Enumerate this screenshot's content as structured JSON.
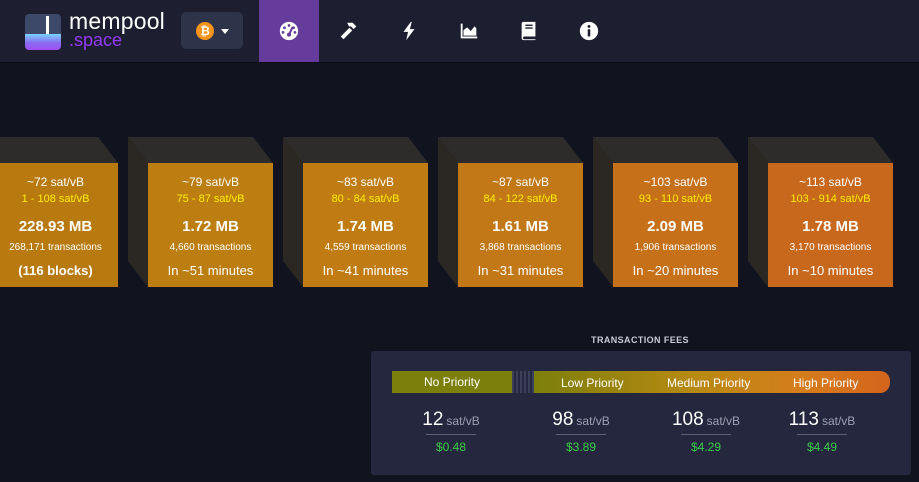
{
  "brand": {
    "name_line1": "mempool",
    "name_line2": ".space",
    "accent": "#9339f4"
  },
  "nav": {
    "network_icon": "bitcoin-icon",
    "items": [
      {
        "icon": "dashboard-gauge-icon",
        "active": true
      },
      {
        "icon": "hammer-icon",
        "active": false
      },
      {
        "icon": "lightning-icon",
        "active": false
      },
      {
        "icon": "graphs-icon",
        "active": false
      },
      {
        "icon": "book-icon",
        "active": false
      },
      {
        "icon": "info-icon",
        "active": false
      }
    ]
  },
  "mempool_blocks": [
    {
      "fee": "~72 sat/vB",
      "range": "1 - 108 sat/vB",
      "size": "228.93 MB",
      "txs": "268,171 transactions",
      "eta": "(116 blocks)"
    },
    {
      "fee": "~79 sat/vB",
      "range": "75 - 87 sat/vB",
      "size": "1.72 MB",
      "txs": "4,660 transactions",
      "eta": "In ~51 minutes"
    },
    {
      "fee": "~83 sat/vB",
      "range": "80 - 84 sat/vB",
      "size": "1.74 MB",
      "txs": "4,559 transactions",
      "eta": "In ~41 minutes"
    },
    {
      "fee": "~87 sat/vB",
      "range": "84 - 122 sat/vB",
      "size": "1.61 MB",
      "txs": "3,868 transactions",
      "eta": "In ~31 minutes"
    },
    {
      "fee": "~103 sat/vB",
      "range": "93 - 110 sat/vB",
      "size": "2.09 MB",
      "txs": "1,906 transactions",
      "eta": "In ~20 minutes"
    },
    {
      "fee": "~113 sat/vB",
      "range": "103 - 914 sat/vB",
      "size": "1.78 MB",
      "txs": "3,170 transactions",
      "eta": "In ~10 minutes"
    }
  ],
  "fees": {
    "title": "TRANSACTION FEES",
    "labels": {
      "none": "No Priority",
      "low": "Low Priority",
      "medium": "Medium Priority",
      "high": "High Priority"
    },
    "unit": "sat/vB",
    "items": [
      {
        "value": "12",
        "usd": "$0.48"
      },
      {
        "value": "98",
        "usd": "$3.89"
      },
      {
        "value": "108",
        "usd": "$4.29"
      },
      {
        "value": "113",
        "usd": "$4.49"
      }
    ]
  }
}
